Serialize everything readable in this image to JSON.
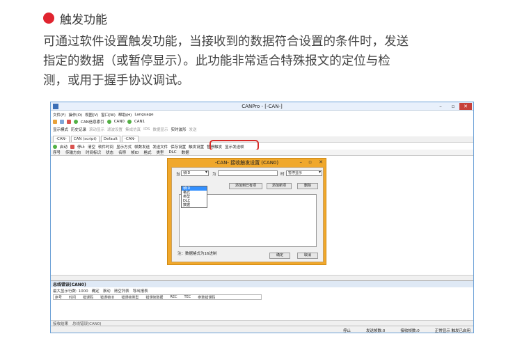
{
  "section": {
    "title": "触发功能",
    "accent": "#e0242f",
    "lines": [
      "可通过软件设置触发功能，当接收到的数据符合设置的条件时，发送",
      "指定的数据（或暂停显示）。此功能非常适合特殊报文的定位与检",
      "测，或用于握手协议调试。"
    ]
  },
  "app": {
    "title": "CANPro - [-CAN-]",
    "menu": [
      "文件(F)",
      "操作(O)",
      "视图(V)",
      "窗口(W)",
      "帮助(H)",
      "Language"
    ],
    "toolbar1": [
      "CAN信息索引",
      "CAN0",
      "CAN1"
    ],
    "toolbar2": [
      "显示模式",
      "历史记录",
      "滚动显示",
      "滤波设置",
      "集成仿真",
      "IDS",
      "数据显示",
      "实时波形",
      "发送"
    ],
    "tabs": [
      "-CAN-",
      "CAN (script)",
      "Default",
      "-CAN-"
    ],
    "toolbar3": [
      "启动",
      "停止",
      "清空",
      "软件时间",
      "显示方式",
      "帧数发送",
      "发送文件",
      "保存设置",
      "触发设置",
      "暂停触发",
      "显示发送帧"
    ],
    "columns": [
      "序号",
      "传输方向",
      "时间标识",
      "状态",
      "名称",
      "帧ID",
      "格式",
      "类型",
      "DLC",
      "数据"
    ],
    "dialog": {
      "title": "-CAN- 接收触发设置 (CAN0)",
      "when_label": "当",
      "when_value": "帧ID",
      "is_label": "为",
      "then_label": "时",
      "then_value": "暂停显示",
      "add_button": "添加到已有项",
      "new_button": "添加新项",
      "delete_button": "删除",
      "dropdown_options": [
        "帧ID",
        "格式",
        "类型",
        "DLC",
        "数据"
      ],
      "note": "注：数据格式为16进制",
      "ok": "确定",
      "cancel": "取消"
    },
    "error_panel": {
      "title": "总线错误(CAN0)",
      "max_lines_label": "最大显示行数: 1000",
      "confirm": "确定",
      "roll": "滚动",
      "clear": "清空列表",
      "export": "导出报表",
      "columns": [
        "序号",
        "时间",
        "错误码",
        "错误帧ID",
        "错误帧类型",
        "错误帧数据",
        "REC",
        "TEC",
        "参数错误码"
      ],
      "bottom_tabs": [
        "接收结果",
        "总线错误(CAN0)"
      ]
    },
    "status": [
      "停止",
      "发送帧数:0",
      "接收帧数:0",
      "正常显示 触发已启用"
    ]
  }
}
